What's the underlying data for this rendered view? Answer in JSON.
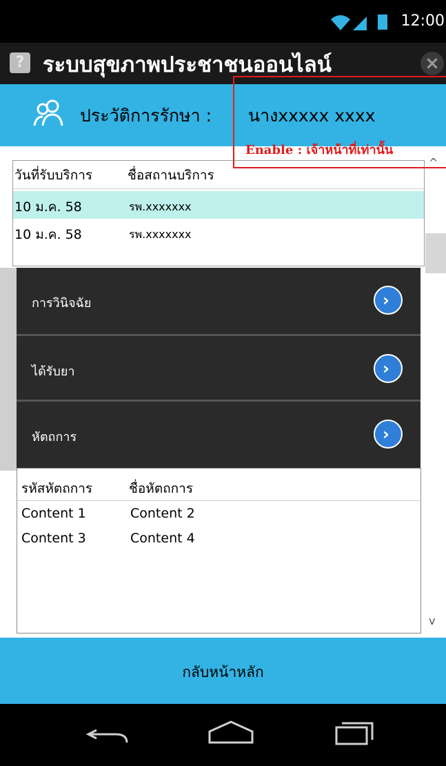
{
  "status_bar": {
    "time": "12:00"
  },
  "title_bar": {
    "title": "ระบบสุขภาพประชาชนออนไลน์",
    "help_glyph": "?",
    "close_glyph": "×"
  },
  "header": {
    "icon": "users-icon",
    "title": "ประวัติการรักษา :",
    "patient_name": "นางxxxxx   xxxx"
  },
  "annotation": {
    "text": "Enable : เจ้าหน้าที่เท่านั้น",
    "color": "#e01c1c"
  },
  "visits_table": {
    "columns": [
      "วันที่รับบริการ",
      "ชื่อสถานบริการ"
    ],
    "rows": [
      {
        "date": "10 ม.ค. 58",
        "facility": "รพ.xxxxxxx",
        "selected": true
      },
      {
        "date": "10 ม.ค. 58",
        "facility": "รพ.xxxxxxx",
        "selected": false
      }
    ]
  },
  "menu": {
    "items": [
      {
        "label": "การวินิจฉัย"
      },
      {
        "label": "ได้รับยา"
      },
      {
        "label": "หัตถการ"
      }
    ]
  },
  "procedures_table": {
    "columns": [
      "รหัสหัตถการ",
      "ชื่อหัตถการ"
    ],
    "rows": [
      [
        "Content 1",
        "Content 2"
      ],
      [
        "Content 3",
        "Content 4"
      ]
    ]
  },
  "footer": {
    "button_label": "กลับหน้าหลัก"
  },
  "nav_bar": {
    "icons": [
      "back-icon",
      "home-icon",
      "recents-icon"
    ]
  },
  "colors": {
    "accent": "#33b3e4",
    "title_bar": "#1a1a1a",
    "menu_bg": "#2a2a2a",
    "selected_row": "#bff1ec"
  }
}
